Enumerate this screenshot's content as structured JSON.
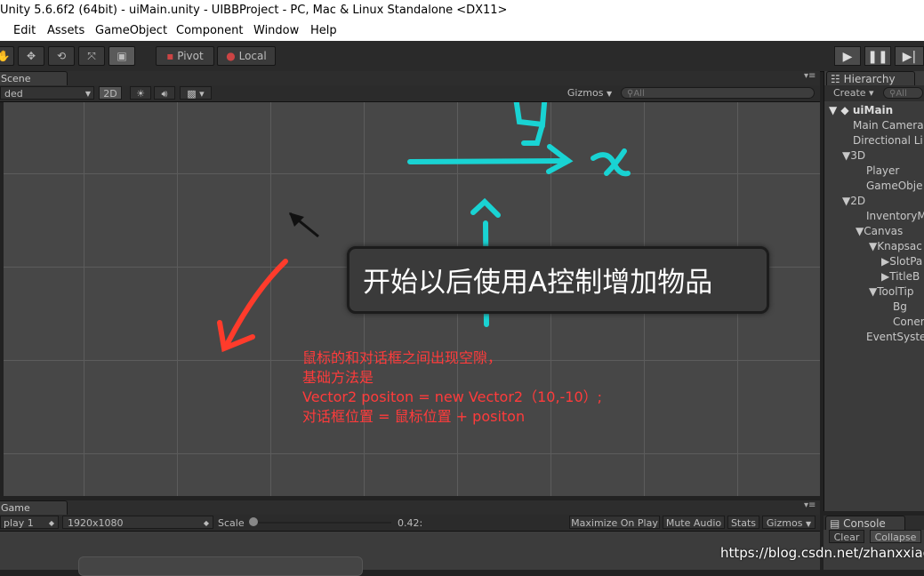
{
  "window": {
    "title": "Unity 5.6.6f2 (64bit) - uiMain.unity - UIBBProject - PC, Mac & Linux Standalone <DX11>"
  },
  "menu": {
    "items": [
      "Edit",
      "Assets",
      "GameObject",
      "Component",
      "Window",
      "Help"
    ]
  },
  "toolbar": {
    "pivot_label": "Pivot",
    "local_label": "Local"
  },
  "scene": {
    "tab_label": "Scene",
    "shading_mode": "ded",
    "mode_2d": "2D",
    "gizmos_label": "Gizmos",
    "search_placeholder": "All",
    "tooltip_text": "开始以后使用A控制增加物品",
    "axis_x": "x",
    "axis_y": "y",
    "note_lines": [
      "鼠标的和对话框之间出现空隙，",
      "基础方法是",
      "Vector2 positon = new Vector2（10,-10）;",
      "对话框位置 = 鼠标位置 + positon"
    ]
  },
  "game": {
    "tab_label": "Game",
    "display": "play 1",
    "resolution": "1920x1080",
    "scale_label": "Scale",
    "scale_value": "0.42:",
    "toggles": [
      "Maximize On Play",
      "Mute Audio",
      "Stats",
      "Gizmos"
    ]
  },
  "hierarchy": {
    "tab_label": "Hierarchy",
    "create_label": "Create",
    "search_placeholder": "All",
    "scene_name": "uiMain",
    "items": [
      "Main Camera",
      "Directional Li",
      "3D",
      "Player",
      "GameObje",
      "2D",
      "InventoryM",
      "Canvas",
      "Knapsac",
      "SlotPa",
      "TitleB",
      "ToolTip",
      "Bg",
      "Coner",
      "EventSyste"
    ]
  },
  "console": {
    "tab_label": "Console",
    "clear_label": "Clear",
    "collapse_label": "Collapse"
  },
  "watermark": "https://blog.csdn.net/zhanxxiao",
  "colors": {
    "annotation_red": "#ff3b3b",
    "axis_cyan": "#19d3d3",
    "editor_bg": "#474747"
  }
}
